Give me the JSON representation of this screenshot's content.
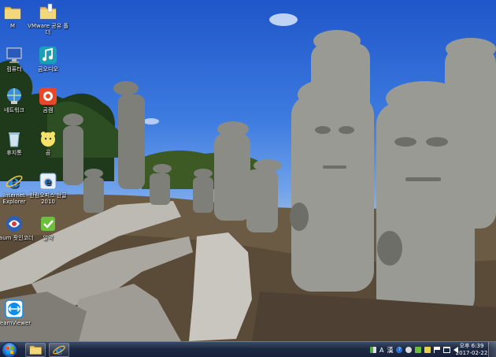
{
  "desktop": {
    "icons": [
      {
        "label": "M",
        "icon": "folder-icon"
      },
      {
        "label": "VMware 공유 폴더",
        "icon": "shared-folder-icon"
      },
      {
        "label": "컴퓨터",
        "icon": "computer-icon"
      },
      {
        "label": "곰오디오",
        "icon": "music-app-icon"
      },
      {
        "label": "네트워크",
        "icon": "network-icon"
      },
      {
        "label": "곰캠",
        "icon": "camera-app-icon"
      },
      {
        "label": "휴지통",
        "icon": "recycle-bin-icon"
      },
      {
        "label": "곰",
        "icon": "bear-app-icon"
      },
      {
        "label": "Internet Explorer",
        "icon": "internet-explorer-icon"
      },
      {
        "label": "한컴오피스 한글 2010",
        "icon": "hwp-icon"
      },
      {
        "label": "Daum 팟인코더",
        "icon": "encoder-icon"
      },
      {
        "label": "알약",
        "icon": "antivirus-icon"
      },
      {
        "label": "TeamViewer",
        "icon": "teamviewer-icon"
      }
    ]
  },
  "taskbar": {
    "pinned": [
      {
        "name": "file-explorer",
        "icon": "folder-icon"
      },
      {
        "name": "internet-explorer",
        "icon": "internet-explorer-icon"
      }
    ],
    "tray": {
      "ime_lang": "A",
      "ime_mode": "漢",
      "time": "오후 6:39",
      "date": "2017-02-22"
    }
  },
  "colors": {
    "taskbar": "#1e2a44",
    "sky": "#2f6ad6",
    "stone": "#8a8a86"
  }
}
